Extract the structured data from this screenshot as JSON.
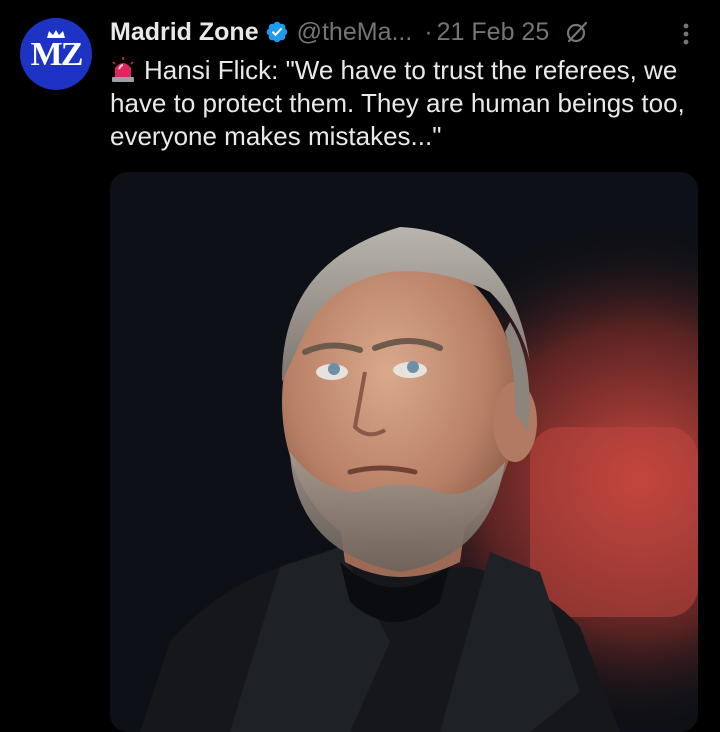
{
  "tweet": {
    "author": {
      "name": "Madrid Zone",
      "handle": "@theMa...",
      "avatar_text": "MZ",
      "verified": true,
      "verified_icon": "verified-badge-icon"
    },
    "separator": "·",
    "date": "21 Feb 25",
    "grok_icon": "grok-icon",
    "more_icon": "more-dots-icon",
    "emoji_icon": "police-siren-icon",
    "text": "Hansi Flick: \"We have to trust the referees, we have to protect them. They are human beings too, everyone makes mistakes...\"",
    "media_icon": "photo-portrait"
  },
  "colors": {
    "background": "#000000",
    "text": "#e7e9ea",
    "muted": "#71767b",
    "verified": "#1d9bf0",
    "avatar_bg": "#1d33c4"
  }
}
